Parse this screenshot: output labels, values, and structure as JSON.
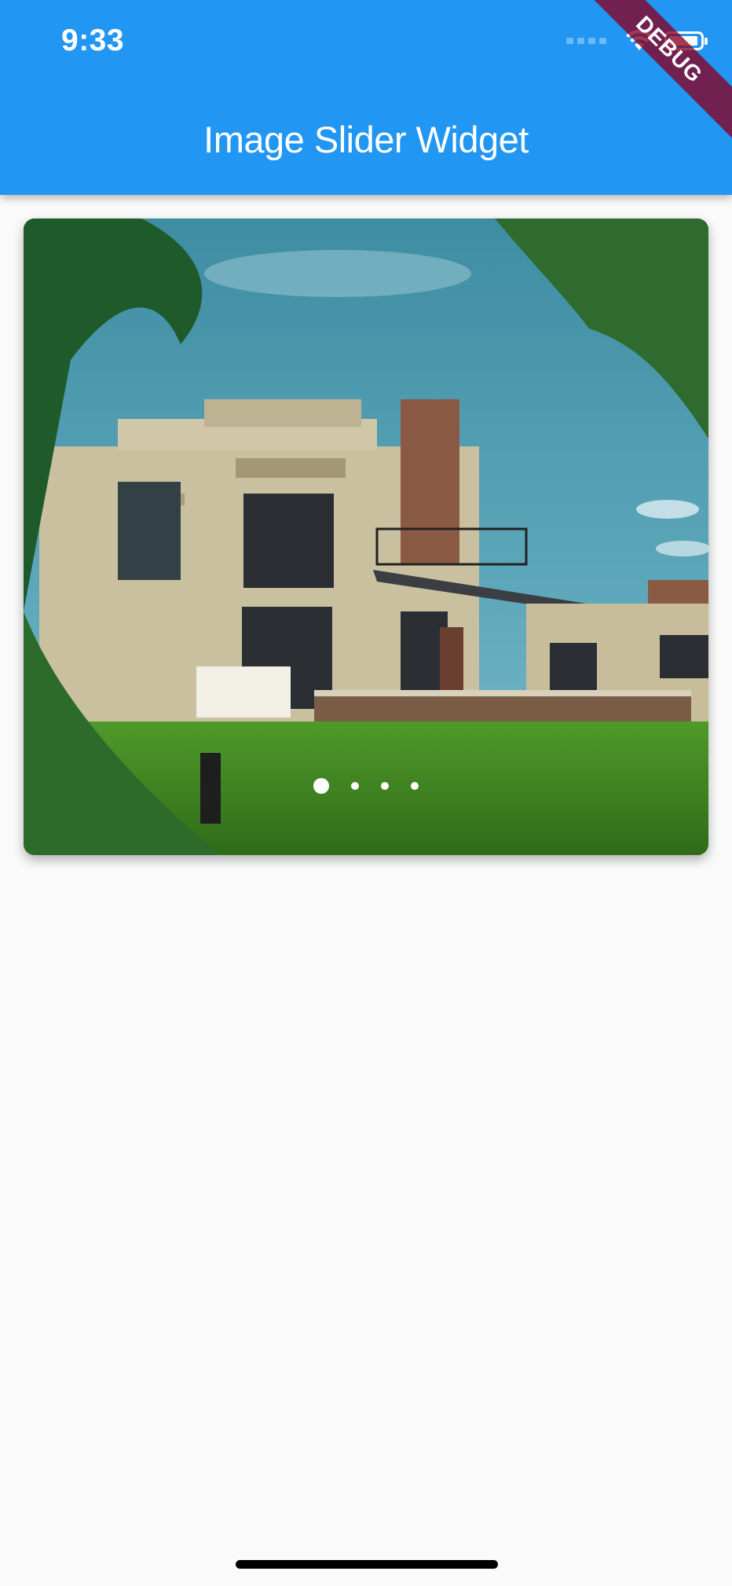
{
  "status_bar": {
    "time": "9:33"
  },
  "app_bar": {
    "title": "Image Slider Widget"
  },
  "debug_banner": {
    "label": "DEBUG"
  },
  "slider": {
    "slides": 4,
    "active_index": 0,
    "image_description": "house-photo"
  },
  "colors": {
    "primary": "#2196f3",
    "background": "#fafafa",
    "banner": "#880020"
  }
}
